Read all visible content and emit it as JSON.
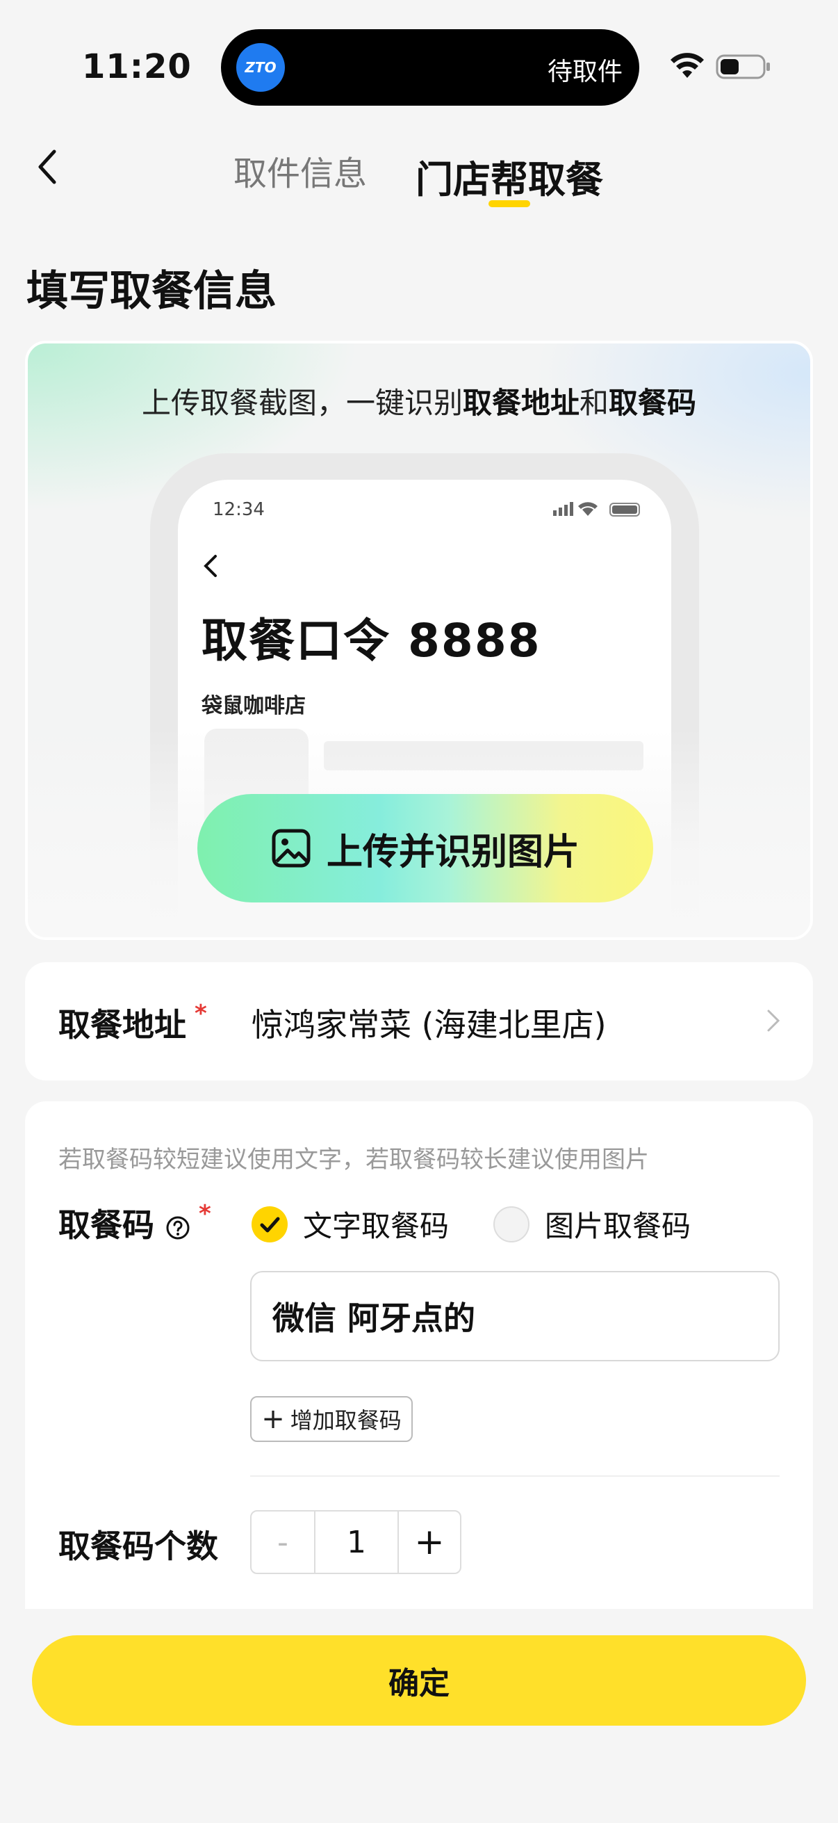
{
  "status_bar": {
    "time": "11:20",
    "island_logo_text": "ZTO",
    "island_text": "待取件"
  },
  "nav": {
    "tabs": [
      {
        "label": "取件信息",
        "active": false
      },
      {
        "label": "门店帮取餐",
        "active": true
      }
    ],
    "accent": "#ffd400"
  },
  "page_title": "填写取餐信息",
  "upload_card": {
    "hint_prefix": "上传取餐截图，一键识别",
    "hint_bold_1": "取餐地址",
    "hint_mid": "和",
    "hint_bold_2": "取餐码",
    "mock_phone": {
      "time": "12:34",
      "title": "取餐口令 8888",
      "shop": "袋鼠咖啡店"
    },
    "button_label": "上传并识别图片",
    "button_icon": "image-icon"
  },
  "address": {
    "label": "取餐地址",
    "required_mark": "*",
    "value": "惊鸿家常菜 (海建北里店)"
  },
  "code": {
    "hint": "若取餐码较短建议使用文字，若取餐码较长建议使用图片",
    "label": "取餐码",
    "required_mark": "*",
    "options": [
      {
        "label": "文字取餐码",
        "selected": true
      },
      {
        "label": "图片取餐码",
        "selected": false
      }
    ],
    "input_value": "微信 阿牙点的",
    "add_button": "增加取餐码",
    "add_button_icon": "+"
  },
  "count": {
    "label": "取餐码个数",
    "minus": "-",
    "value": "1",
    "plus": "+"
  },
  "confirm_label": "确定",
  "colors": {
    "primary_yellow": "#ffe02a",
    "required_red": "#e53935"
  }
}
